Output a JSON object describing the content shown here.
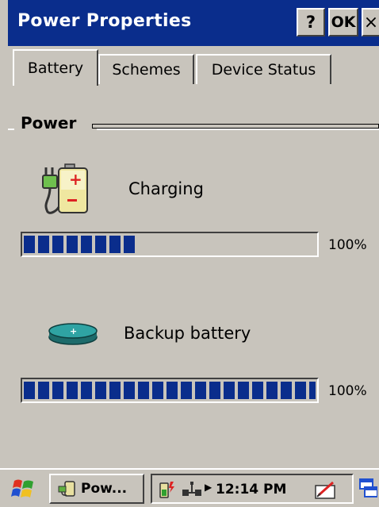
{
  "window": {
    "title": "Power Properties",
    "help_label": "?",
    "ok_label": "OK",
    "close_label": "×"
  },
  "tabs": [
    {
      "label": "Battery",
      "selected": true
    },
    {
      "label": "Schemes",
      "selected": false
    },
    {
      "label": "Device Status",
      "selected": false
    }
  ],
  "content": {
    "power_label": "Power",
    "main_battery": {
      "status": "Charging",
      "percent_text": "100%",
      "level": 0.38
    },
    "backup_battery": {
      "label": "Backup battery",
      "percent_text": "100%",
      "level": 1.0
    }
  },
  "taskbar": {
    "task_label": "Pow...",
    "time": "12:14 PM"
  },
  "icons": {
    "start": "windows-flag-icon",
    "charging": "battery-plug-icon",
    "backup": "coin-cell-icon",
    "tray_battery": "battery-charging-icon",
    "tray_network": "network-icon",
    "tray_input": "input-panel-icon",
    "desktop": "show-desktop-icon"
  },
  "colors": {
    "titlebar": "#0a2d8c",
    "progress_fill": "#0a2d8c",
    "face": "#c8c4bc"
  }
}
